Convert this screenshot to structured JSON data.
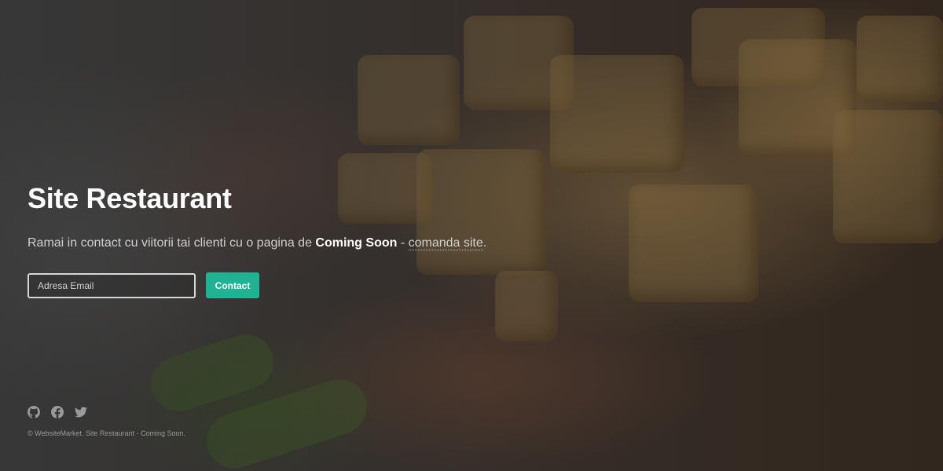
{
  "hero": {
    "title": "Site Restaurant",
    "tagline_before": "Ramai in contact cu viitorii tai clienti cu o pagina de ",
    "tagline_strong": "Coming Soon",
    "tagline_middle": " - ",
    "tagline_link": "comanda site",
    "tagline_after": "."
  },
  "form": {
    "email_placeholder": "Adresa Email",
    "email_value": "",
    "submit_label": "Contact"
  },
  "social": [
    {
      "icon": "github-icon"
    },
    {
      "icon": "facebook-icon"
    },
    {
      "icon": "twitter-icon"
    }
  ],
  "footer": {
    "copyright": "© WebsiteMarket. Site Restaurant - Coming Soon."
  },
  "colors": {
    "accent": "#1fb394",
    "title": "#ffffff",
    "muted_text": "#9a9a9a"
  }
}
